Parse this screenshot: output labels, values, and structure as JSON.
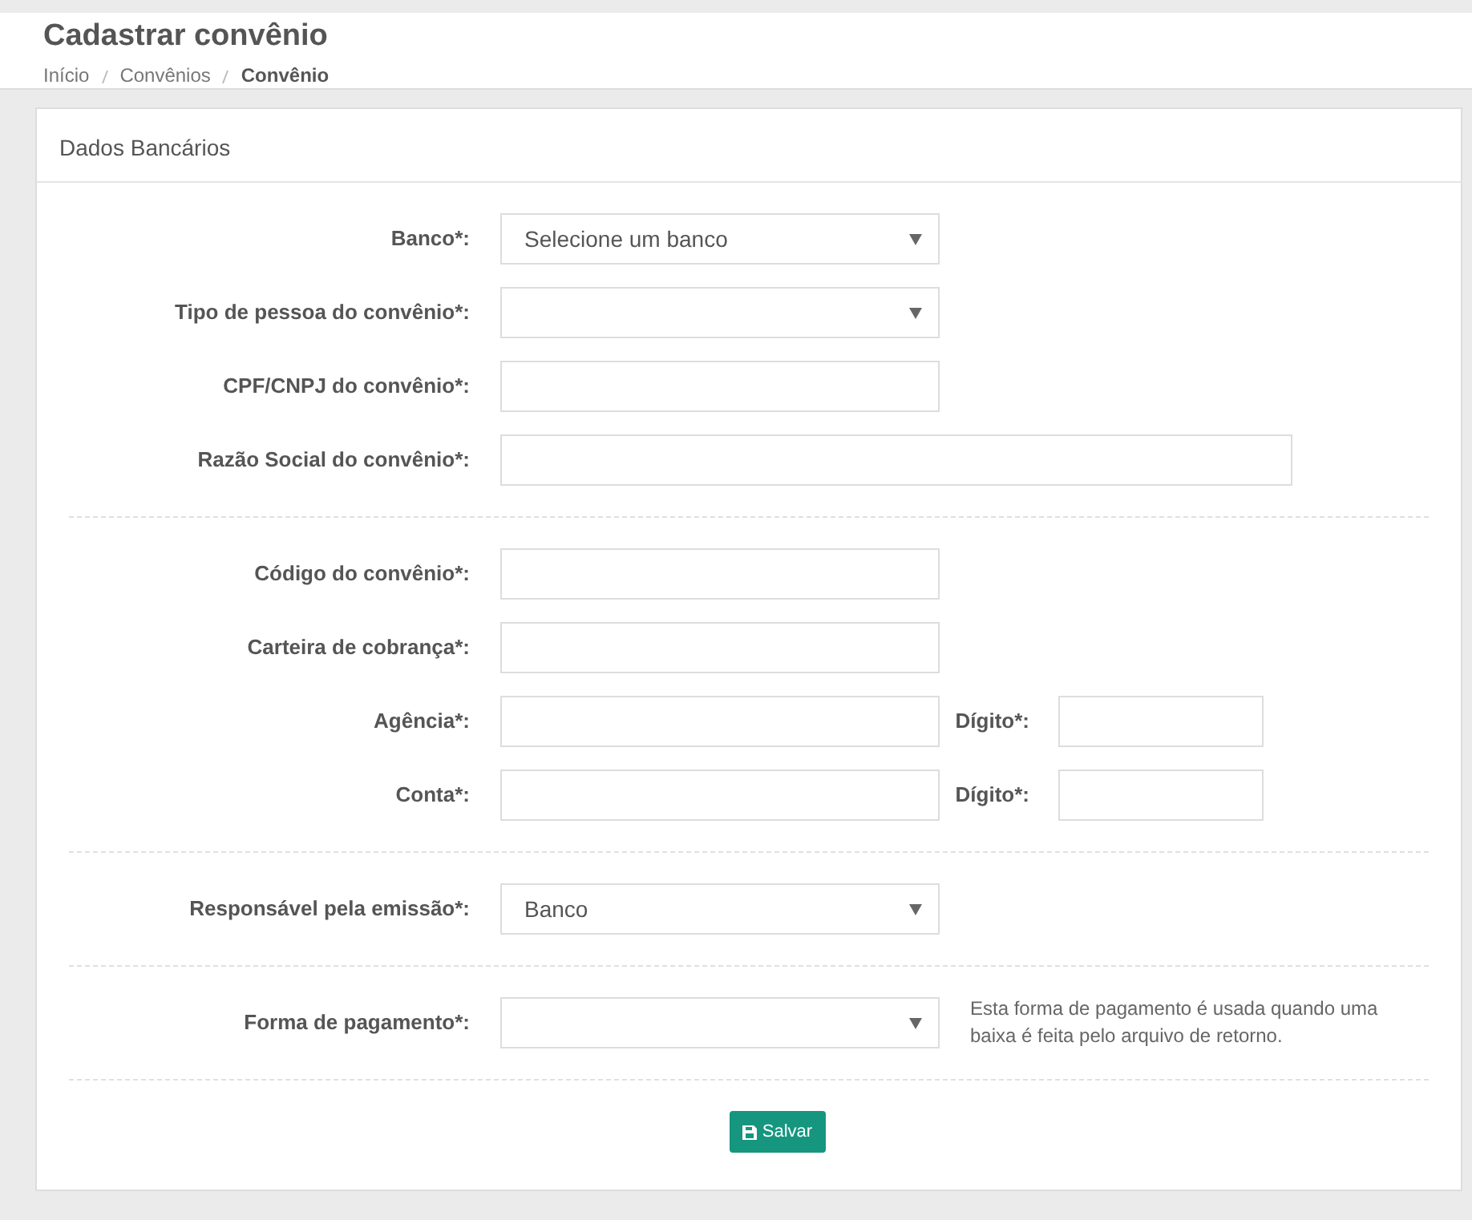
{
  "header": {
    "title": "Cadastrar convênio",
    "breadcrumb": [
      {
        "label": "Início",
        "current": false
      },
      {
        "label": "Convênios",
        "current": false
      },
      {
        "label": "Convênio",
        "current": true
      }
    ]
  },
  "card": {
    "title": "Dados Bancários",
    "sections": [
      {
        "rows": [
          {
            "kind": "select",
            "label": "Banco*:",
            "value": "Selecione um banco"
          },
          {
            "kind": "select",
            "label": "Tipo de pessoa do convênio*:"
          },
          {
            "kind": "input",
            "label": "CPF/CNPJ do convênio*:"
          },
          {
            "kind": "input-wide",
            "label": "Razão Social do convênio*:"
          }
        ]
      },
      {
        "rows": [
          {
            "kind": "input",
            "label": "Código do convênio*:"
          },
          {
            "kind": "input",
            "label": "Carteira de cobrança*:"
          },
          {
            "kind": "pair",
            "label": "Agência*:",
            "second_label": "Dígito*:"
          },
          {
            "kind": "pair",
            "label": "Conta*:",
            "second_label": "Dígito*:"
          }
        ]
      },
      {
        "rows": [
          {
            "kind": "select",
            "label": "Responsável pela emissão*:",
            "value": "Banco"
          }
        ]
      },
      {
        "rows": [
          {
            "kind": "select",
            "label": "Forma de pagamento*:",
            "help": "Esta forma de pagamento é usada quando uma baixa é feita pelo arquivo de retorno."
          }
        ]
      }
    ],
    "button": "Salvar"
  }
}
